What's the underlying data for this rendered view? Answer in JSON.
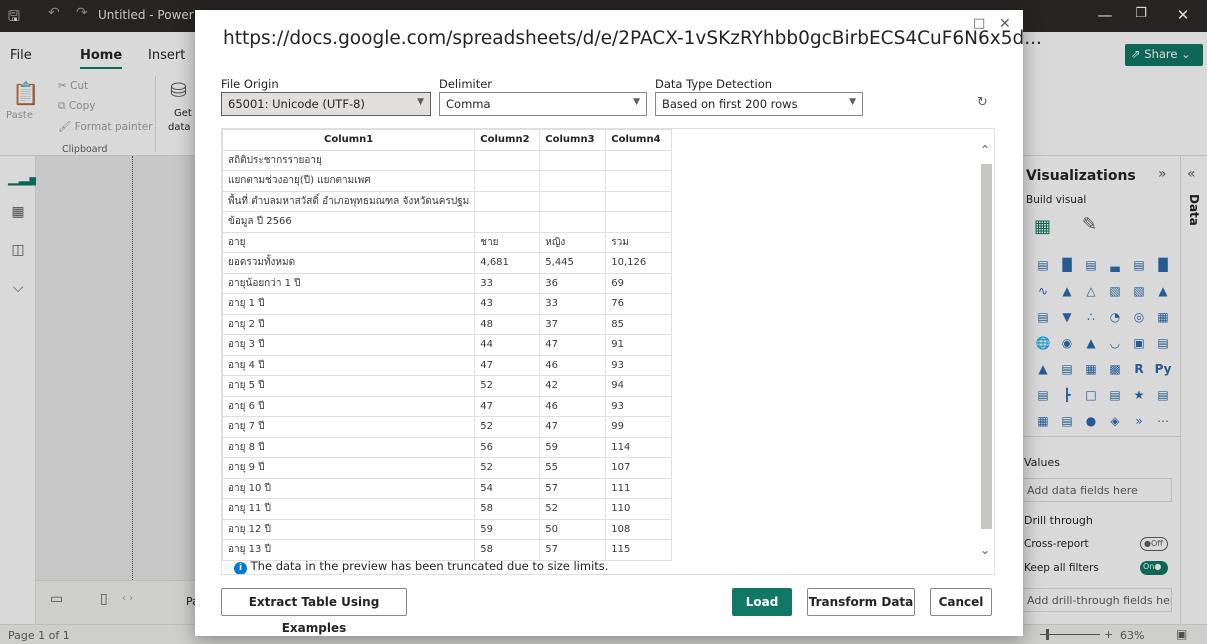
{
  "window": {
    "title": "Untitled - Power BI"
  },
  "ribbon": {
    "tabs": [
      "File",
      "Home",
      "Insert"
    ],
    "paste": "Paste",
    "cut": "Cut",
    "copy": "Copy",
    "format_painter": "Format painter",
    "clipboard": "Clipboard",
    "get": "Get",
    "data": "data",
    "share": "Share"
  },
  "status": {
    "page": "Page 1 of 1",
    "zoom": "63%",
    "page_tab": "Pa"
  },
  "viz": {
    "title": "Visualizations",
    "build": "Build visual",
    "values": "Values",
    "values_placeholder": "Add data fields here",
    "drill": "Drill through",
    "cross": "Cross-report",
    "cross_state": "Off",
    "keep": "Keep all filters",
    "keep_state": "On",
    "drill_placeholder": "Add drill-through fields here",
    "data_tab": "Data"
  },
  "dialog": {
    "title": "https://docs.google.com/spreadsheets/d/e/2PACX-1vSKzRYhbb0gcBirbECS4CuF6N6x5d...",
    "file_origin_label": "File Origin",
    "file_origin": "65001: Unicode (UTF-8)",
    "delimiter_label": "Delimiter",
    "delimiter": "Comma",
    "detection_label": "Data Type Detection",
    "detection": "Based on first 200 rows",
    "columns": [
      "Column1",
      "Column2",
      "Column3",
      "Column4"
    ],
    "rows": [
      [
        "สถิติประชากรรายอายุ",
        "",
        "",
        ""
      ],
      [
        "แยกตามช่วงอายุ(ปี) แยกตามเพศ",
        "",
        "",
        ""
      ],
      [
        "พื้นที่ ตำบลมหาสวัสดิ์ อำเภอพุทธมณฑล จังหวัดนครปฐม",
        "",
        "",
        ""
      ],
      [
        "ข้อมูล ปี 2566",
        "",
        "",
        ""
      ],
      [
        "อายุ",
        "ชาย",
        "หญิง",
        "รวม"
      ],
      [
        "ยอดรวมทั้งหมด",
        "4,681",
        "5,445",
        "10,126"
      ],
      [
        "อายุน้อยกว่า 1 ปี",
        "33",
        "36",
        "69"
      ],
      [
        "อายุ 1 ปี",
        "43",
        "33",
        "76"
      ],
      [
        "อายุ 2 ปี",
        "48",
        "37",
        "85"
      ],
      [
        "อายุ 3 ปี",
        "44",
        "47",
        "91"
      ],
      [
        "อายุ 4 ปี",
        "47",
        "46",
        "93"
      ],
      [
        "อายุ 5 ปี",
        "52",
        "42",
        "94"
      ],
      [
        "อายุ 6 ปี",
        "47",
        "46",
        "93"
      ],
      [
        "อายุ 7 ปี",
        "52",
        "47",
        "99"
      ],
      [
        "อายุ 8 ปี",
        "56",
        "59",
        "114"
      ],
      [
        "อายุ 9 ปี",
        "52",
        "55",
        "107"
      ],
      [
        "อายุ 10 ปี",
        "54",
        "57",
        "111"
      ],
      [
        "อายุ 11 ปี",
        "58",
        "52",
        "110"
      ],
      [
        "อายุ 12 ปี",
        "59",
        "50",
        "108"
      ],
      [
        "อายุ 13 ปี",
        "58",
        "57",
        "115"
      ]
    ],
    "info": "The data in the preview has been truncated due to size limits.",
    "extract_btn": "Extract Table Using Examples",
    "load_btn": "Load",
    "transform_btn": "Transform Data",
    "cancel_btn": "Cancel",
    "accent": "#117865"
  }
}
